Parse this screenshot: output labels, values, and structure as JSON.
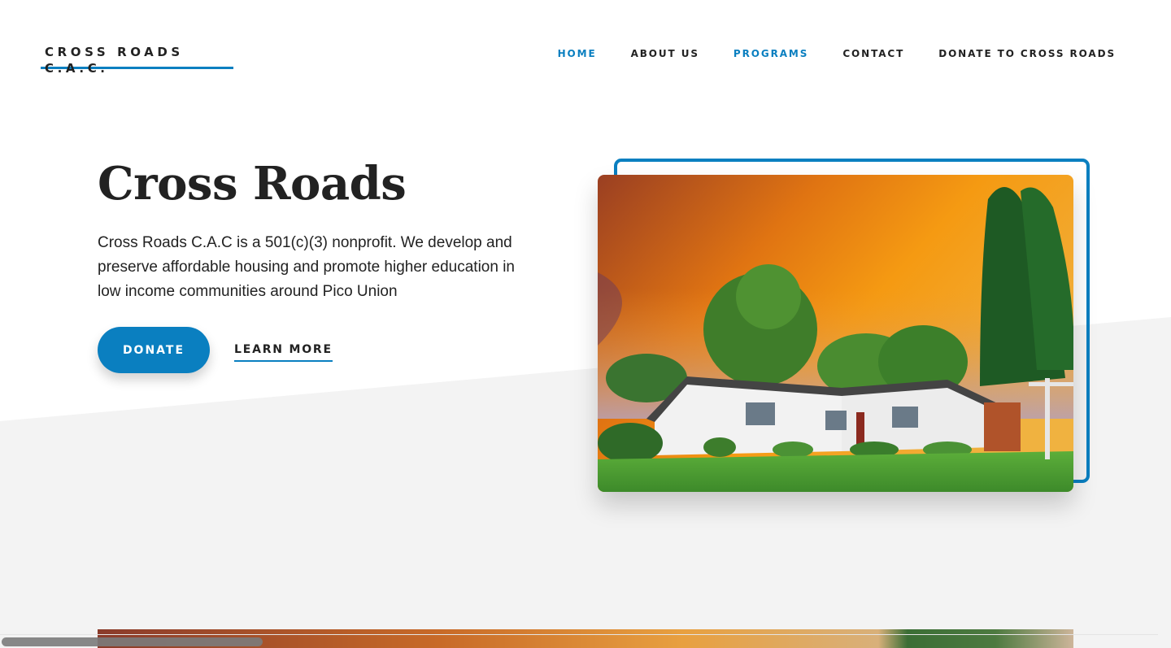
{
  "header": {
    "logo": "CROSS ROADS C.A.C.",
    "nav": [
      {
        "label": "HOME",
        "active": true
      },
      {
        "label": "ABOUT US",
        "active": false
      },
      {
        "label": "PROGRAMS",
        "active": true
      },
      {
        "label": "CONTACT",
        "active": false
      },
      {
        "label": "DONATE TO CROSS ROADS",
        "active": false
      }
    ]
  },
  "hero": {
    "title": "Cross Roads",
    "description": "Cross Roads C.A.C is a 501(c)(3) nonprofit. We develop and preserve affordable housing and promote higher education in low income communities around Pico Union",
    "donate_label": "DONATE",
    "learn_more_label": "LEARN MORE",
    "image_icon": "house-photo"
  },
  "colors": {
    "accent": "#0a7fc0",
    "text": "#222222",
    "section_bg": "#f3f3f3"
  }
}
